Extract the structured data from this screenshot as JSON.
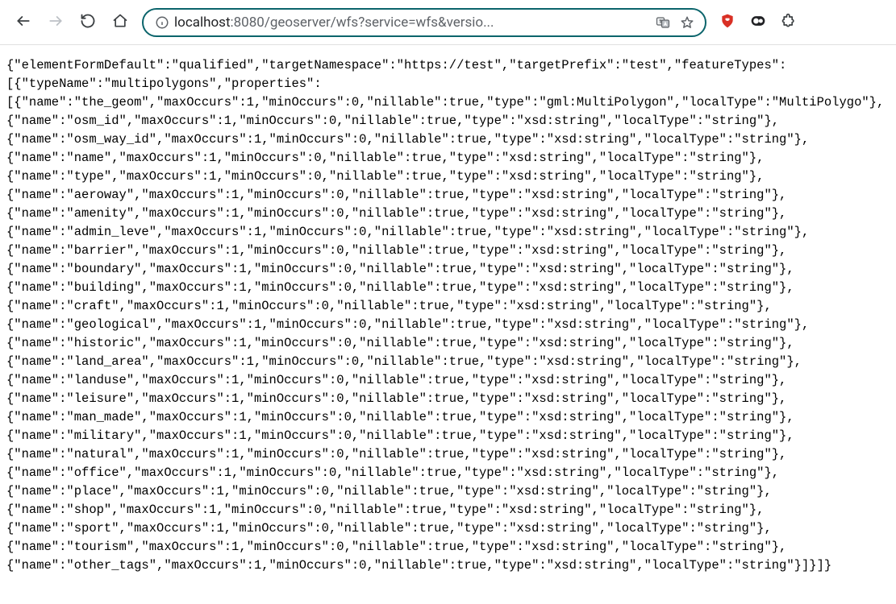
{
  "toolbar": {
    "url_host": "localhost",
    "url_rest": ":8080/geoserver/wfs?service=wfs&versio..."
  },
  "response": {
    "elementFormDefault": "qualified",
    "targetNamespace": "https://test",
    "targetPrefix": "test",
    "featureTypes": [
      {
        "typeName": "multipolygons",
        "properties": [
          {
            "name": "the_geom",
            "maxOccurs": 1,
            "minOccurs": 0,
            "nillable": true,
            "type": "gml:MultiPolygon",
            "localType": "MultiPolygo"
          },
          {
            "name": "osm_id",
            "maxOccurs": 1,
            "minOccurs": 0,
            "nillable": true,
            "type": "xsd:string",
            "localType": "string"
          },
          {
            "name": "osm_way_id",
            "maxOccurs": 1,
            "minOccurs": 0,
            "nillable": true,
            "type": "xsd:string",
            "localType": "string"
          },
          {
            "name": "name",
            "maxOccurs": 1,
            "minOccurs": 0,
            "nillable": true,
            "type": "xsd:string",
            "localType": "string"
          },
          {
            "name": "type",
            "maxOccurs": 1,
            "minOccurs": 0,
            "nillable": true,
            "type": "xsd:string",
            "localType": "string"
          },
          {
            "name": "aeroway",
            "maxOccurs": 1,
            "minOccurs": 0,
            "nillable": true,
            "type": "xsd:string",
            "localType": "string"
          },
          {
            "name": "amenity",
            "maxOccurs": 1,
            "minOccurs": 0,
            "nillable": true,
            "type": "xsd:string",
            "localType": "string"
          },
          {
            "name": "admin_leve",
            "maxOccurs": 1,
            "minOccurs": 0,
            "nillable": true,
            "type": "xsd:string",
            "localType": "string"
          },
          {
            "name": "barrier",
            "maxOccurs": 1,
            "minOccurs": 0,
            "nillable": true,
            "type": "xsd:string",
            "localType": "string"
          },
          {
            "name": "boundary",
            "maxOccurs": 1,
            "minOccurs": 0,
            "nillable": true,
            "type": "xsd:string",
            "localType": "string"
          },
          {
            "name": "building",
            "maxOccurs": 1,
            "minOccurs": 0,
            "nillable": true,
            "type": "xsd:string",
            "localType": "string"
          },
          {
            "name": "craft",
            "maxOccurs": 1,
            "minOccurs": 0,
            "nillable": true,
            "type": "xsd:string",
            "localType": "string"
          },
          {
            "name": "geological",
            "maxOccurs": 1,
            "minOccurs": 0,
            "nillable": true,
            "type": "xsd:string",
            "localType": "string"
          },
          {
            "name": "historic",
            "maxOccurs": 1,
            "minOccurs": 0,
            "nillable": true,
            "type": "xsd:string",
            "localType": "string"
          },
          {
            "name": "land_area",
            "maxOccurs": 1,
            "minOccurs": 0,
            "nillable": true,
            "type": "xsd:string",
            "localType": "string"
          },
          {
            "name": "landuse",
            "maxOccurs": 1,
            "minOccurs": 0,
            "nillable": true,
            "type": "xsd:string",
            "localType": "string"
          },
          {
            "name": "leisure",
            "maxOccurs": 1,
            "minOccurs": 0,
            "nillable": true,
            "type": "xsd:string",
            "localType": "string"
          },
          {
            "name": "man_made",
            "maxOccurs": 1,
            "minOccurs": 0,
            "nillable": true,
            "type": "xsd:string",
            "localType": "string"
          },
          {
            "name": "military",
            "maxOccurs": 1,
            "minOccurs": 0,
            "nillable": true,
            "type": "xsd:string",
            "localType": "string"
          },
          {
            "name": "natural",
            "maxOccurs": 1,
            "minOccurs": 0,
            "nillable": true,
            "type": "xsd:string",
            "localType": "string"
          },
          {
            "name": "office",
            "maxOccurs": 1,
            "minOccurs": 0,
            "nillable": true,
            "type": "xsd:string",
            "localType": "string"
          },
          {
            "name": "place",
            "maxOccurs": 1,
            "minOccurs": 0,
            "nillable": true,
            "type": "xsd:string",
            "localType": "string"
          },
          {
            "name": "shop",
            "maxOccurs": 1,
            "minOccurs": 0,
            "nillable": true,
            "type": "xsd:string",
            "localType": "string"
          },
          {
            "name": "sport",
            "maxOccurs": 1,
            "minOccurs": 0,
            "nillable": true,
            "type": "xsd:string",
            "localType": "string"
          },
          {
            "name": "tourism",
            "maxOccurs": 1,
            "minOccurs": 0,
            "nillable": true,
            "type": "xsd:string",
            "localType": "string"
          },
          {
            "name": "other_tags",
            "maxOccurs": 1,
            "minOccurs": 0,
            "nillable": true,
            "type": "xsd:string",
            "localType": "string"
          }
        ]
      }
    ]
  }
}
